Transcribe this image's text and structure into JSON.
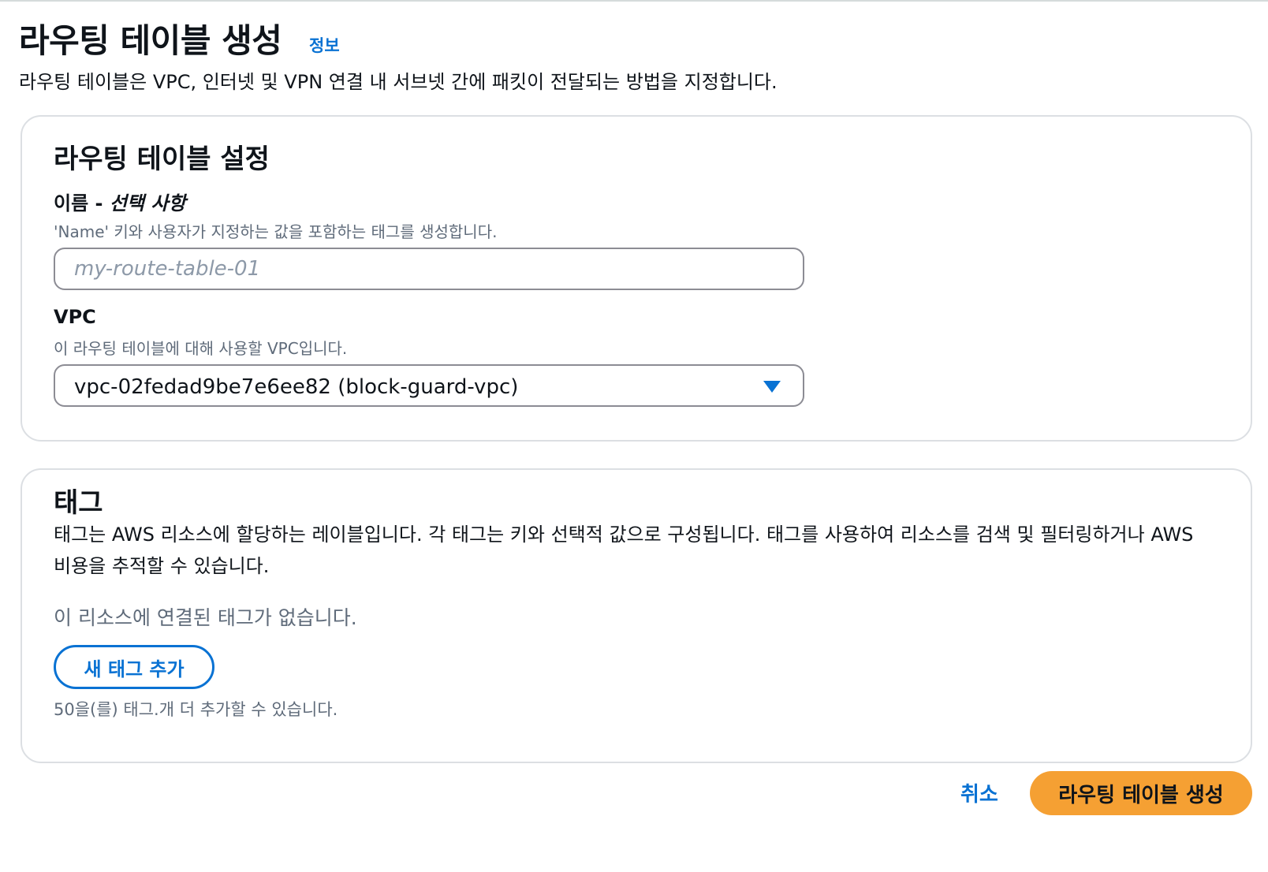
{
  "header": {
    "title": "라우팅 테이블 생성",
    "info_link": "정보",
    "description": "라우팅 테이블은 VPC, 인터넷 및 VPN 연결 내 서브넷 간에 패킷이 전달되는 방법을 지정합니다."
  },
  "settings": {
    "title": "라우팅 테이블 설정",
    "name_field": {
      "label": "이름 - ",
      "label_optional": "선택 사항",
      "description": "'Name' 키와 사용자가 지정하는 값을 포함하는 태그를 생성합니다.",
      "value": "",
      "placeholder": "my-route-table-01"
    },
    "vpc_field": {
      "label": "VPC",
      "description": "이 라우팅 테이블에 대해 사용할 VPC입니다.",
      "selected": "vpc-02fedad9be7e6ee82 (block-guard-vpc)"
    }
  },
  "tags": {
    "title": "태그",
    "description": "태그는 AWS 리소스에 할당하는 레이블입니다. 각 태그는 키와 선택적 값으로 구성됩니다. 태그를 사용하여 리소스를 검색 및 필터링하거나 AWS 비용을 추적할 수 있습니다.",
    "empty_text": "이 리소스에 연결된 태그가 없습니다.",
    "add_button": "새 태그 추가",
    "limit_text": "50을(를) 태그.개 더 추가할 수 있습니다."
  },
  "footer": {
    "cancel": "취소",
    "create": "라우팅 테이블 생성"
  },
  "colors": {
    "link": "#0972d3",
    "primary_button": "#f5a033",
    "border": "#dcdfe3",
    "secondary_text": "#5f6b7a"
  }
}
